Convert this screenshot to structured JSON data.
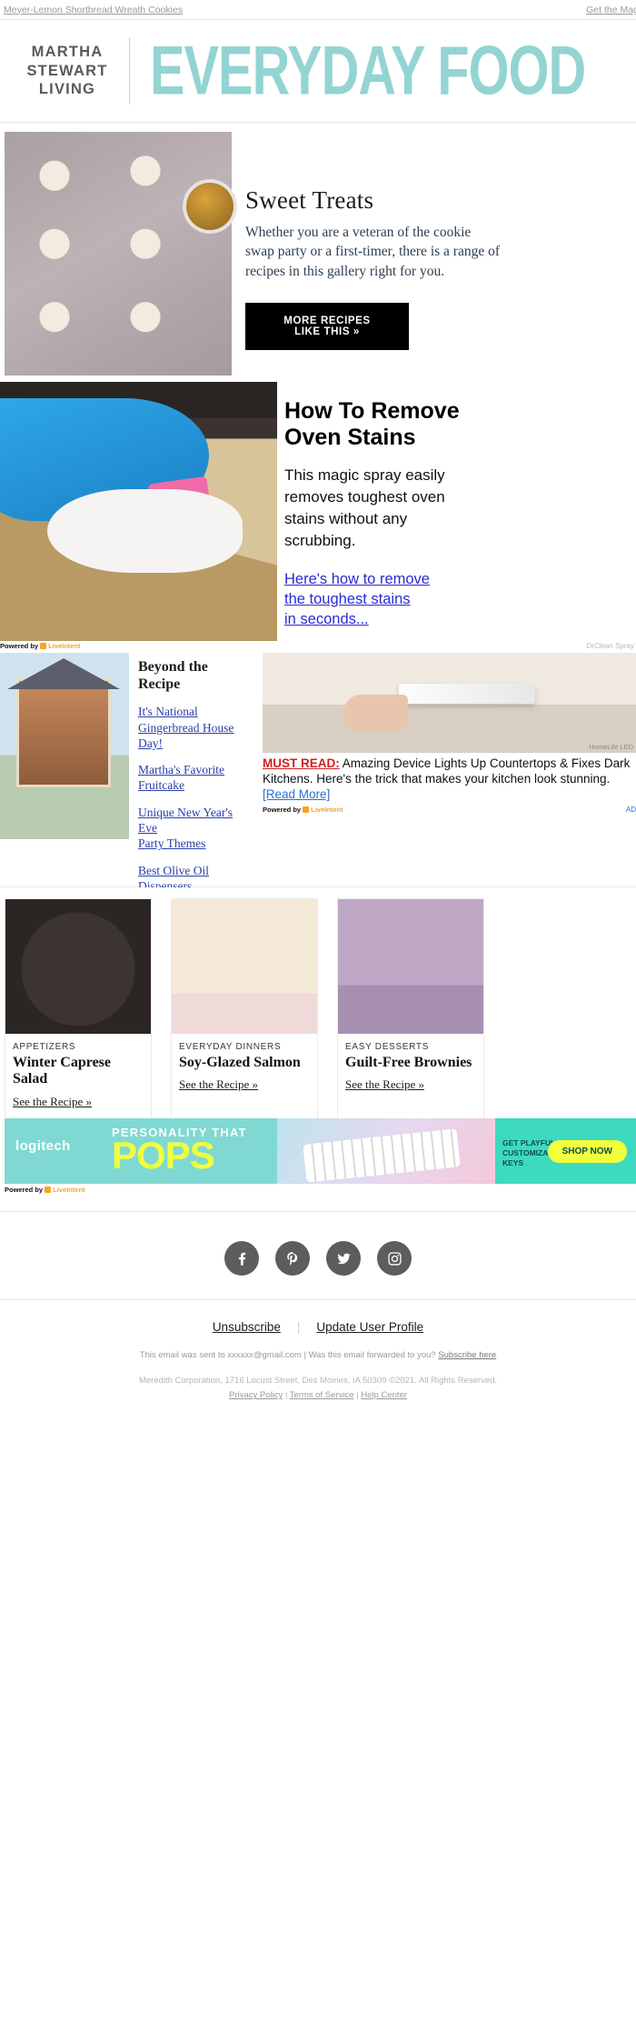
{
  "preheader": {
    "left_link": "Meyer-Lemon Shortbread Wreath Cookies",
    "right_link": "Get the Magazine"
  },
  "masthead": {
    "brand_line1": "MARTHA",
    "brand_line2": "STEWART",
    "brand_line3": "LIVING",
    "title": "EVERYDAY FOOD",
    "accent_color": "#93d4d2"
  },
  "hero": {
    "heading": "Sweet Treats",
    "body": "Whether you are a veteran of the cookie\nswap party or a first-timer, there is a range of\nrecipes in this gallery right for you.",
    "cta": "MORE RECIPES LIKE THIS »",
    "image_alt": "wreath-cookies-photo"
  },
  "oven_ad": {
    "heading": "How To Remove\nOven Stains",
    "body": "This magic spray easily\nremoves toughest oven\nstains without any\nscrubbing.",
    "link": "Here's how to remove\nthe toughest stains\nin seconds...",
    "powered_by": "Powered by",
    "network": "LiveIntent",
    "sponsor": "DrClean Spray",
    "image_alt": "blue-glove-cleaning-oven-photo"
  },
  "beyond": {
    "heading": "Beyond the\nRecipe",
    "links": [
      "It's National\nGingerbread House\nDay!",
      "Martha's Favorite\nFruitcake",
      "Unique New Year's Eve\nParty Themes",
      "Best Olive Oil\nDispensers"
    ],
    "image_alt": "gingerbread-house-photo"
  },
  "must_read_ad": {
    "badge": "MUST READ:",
    "body": " Amazing Device Lights Up Countertops & Fixes Dark Kitchens. Here's the trick that makes your kitchen look stunning. ",
    "read_more": "[Read More]",
    "credit": "HomeLife LED",
    "powered_by": "Powered by",
    "network": "LiveIntent",
    "adchoices": "AD",
    "image_alt": "under-cabinet-led-light-photo"
  },
  "recipe_cards": [
    {
      "kicker": "APPETIZERS",
      "title": "Winter Caprese\nSalad",
      "link": "See the Recipe »",
      "image_alt": "winter-caprese-salad-photo"
    },
    {
      "kicker": "EVERYDAY DINNERS",
      "title": "Soy-Glazed Salmon",
      "link": "See the Recipe »",
      "image_alt": "soy-glazed-salmon-photo"
    },
    {
      "kicker": "EASY DESSERTS",
      "title": "Guilt-Free Brownies",
      "link": "See the Recipe »",
      "image_alt": "guilt-free-brownies-photo"
    }
  ],
  "logitech_ad": {
    "brand": "logitech",
    "tagline": "PERSONALITY THAT",
    "headline": "POPS",
    "subcopy": "GET PLAYFUL WITH CUSTOMIZABLE EMOJI KEYS",
    "cta": "SHOP NOW",
    "powered_by": "Powered by",
    "network": "LiveIntent",
    "accent_color": "#f2ff3d",
    "image_alt": "logitech-pop-keys-keyboard-photo"
  },
  "social": [
    {
      "name": "facebook",
      "glyph": "f"
    },
    {
      "name": "pinterest",
      "glyph": "P"
    },
    {
      "name": "twitter",
      "glyph": "t"
    },
    {
      "name": "instagram",
      "glyph": "i"
    }
  ],
  "footer": {
    "unsubscribe": "Unsubscribe",
    "update_profile": "Update User Profile",
    "sent_to": "This email was sent to xxxxxx@gmail.com  |  Was this email forwarded to you? ",
    "subscribe_here": "Subscribe here",
    "address": "Meredith Corporation, 1716 Locust Street, Des Moines, IA 50309 ©2021. All Rights Reserved.",
    "privacy": "Privacy Policy",
    "terms": "Terms of Service",
    "help": "Help Center"
  }
}
